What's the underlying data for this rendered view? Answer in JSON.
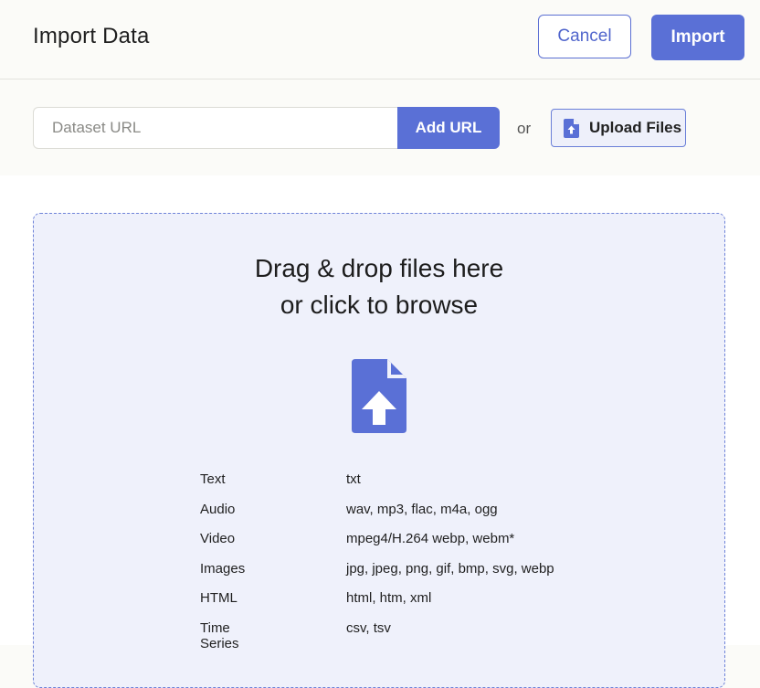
{
  "header": {
    "title": "Import Data",
    "cancel_label": "Cancel",
    "import_label": "Import"
  },
  "url_bar": {
    "placeholder": "Dataset URL",
    "value": "",
    "add_url_label": "Add URL",
    "or_text": "or",
    "upload_label": "Upload Files",
    "upload_icon": "file-upload-icon"
  },
  "dropzone": {
    "line1": "Drag & drop files here",
    "line2": "or click to browse",
    "icon": "file-upload-icon",
    "file_types": [
      {
        "category": "Text",
        "extensions": "txt"
      },
      {
        "category": "Audio",
        "extensions": "wav, mp3, flac, m4a, ogg"
      },
      {
        "category": "Video",
        "extensions": "mpeg4/H.264 webp, webm*"
      },
      {
        "category": "Images",
        "extensions": "jpg, jpeg, png, gif, bmp, svg, webp"
      },
      {
        "category": "HTML",
        "extensions": "html, htm, xml"
      },
      {
        "category": "Time Series",
        "extensions": "csv, tsv"
      }
    ]
  },
  "colors": {
    "accent": "#5a70d6",
    "dropzone_bg": "#eff1fb",
    "page_bg": "#fbfbf8"
  }
}
